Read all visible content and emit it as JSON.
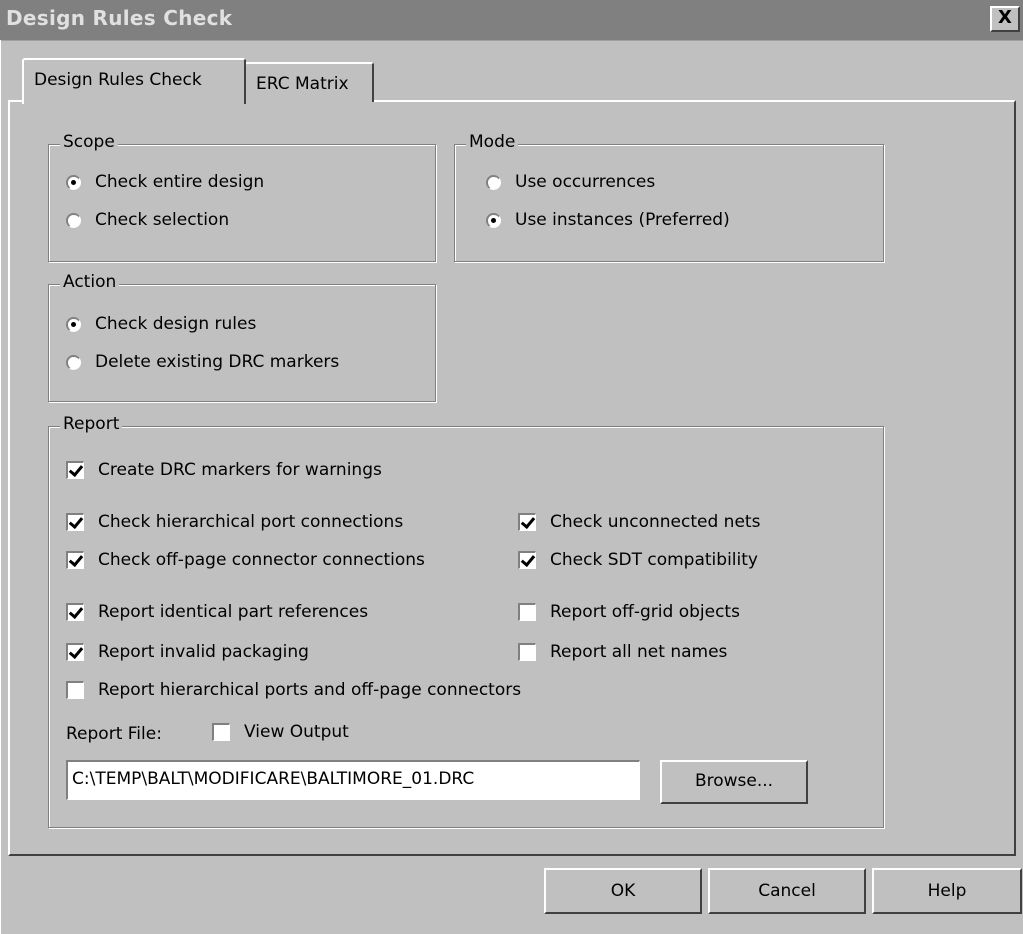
{
  "window": {
    "title": "Design Rules Check",
    "close_glyph": "X"
  },
  "tabs": [
    {
      "label": "Design Rules Check",
      "active": true
    },
    {
      "label": "ERC Matrix",
      "active": false
    }
  ],
  "scope": {
    "legend": "Scope",
    "options": [
      {
        "label": "Check entire design",
        "selected": true
      },
      {
        "label": "Check selection",
        "selected": false
      }
    ]
  },
  "mode": {
    "legend": "Mode",
    "options": [
      {
        "label": "Use occurrences",
        "selected": false
      },
      {
        "label": "Use instances (Preferred)",
        "selected": true
      }
    ]
  },
  "action": {
    "legend": "Action",
    "options": [
      {
        "label": "Check design rules",
        "selected": true
      },
      {
        "label": "Delete existing DRC markers",
        "selected": false
      }
    ]
  },
  "report": {
    "legend": "Report",
    "checks": [
      {
        "label": "Create DRC markers for warnings",
        "checked": true
      },
      {
        "label": "Check hierarchical port connections",
        "checked": true
      },
      {
        "label": "Check unconnected nets",
        "checked": true
      },
      {
        "label": "Check off-page connector connections",
        "checked": true
      },
      {
        "label": "Check SDT compatibility",
        "checked": true
      },
      {
        "label": "Report identical part references",
        "checked": true
      },
      {
        "label": "Report off-grid objects",
        "checked": false
      },
      {
        "label": "Report invalid packaging",
        "checked": true
      },
      {
        "label": "Report all net names",
        "checked": false
      },
      {
        "label": "Report hierarchical ports and off-page connectors",
        "checked": false
      }
    ],
    "report_file_label": "Report File:",
    "view_output": {
      "label": "View Output",
      "checked": false
    },
    "file_path": "C:\\TEMP\\BALT\\MODIFICARE\\BALTIMORE_01.DRC",
    "browse_label": "Browse..."
  },
  "footer": {
    "ok_label": "OK",
    "cancel_label": "Cancel",
    "help_label": "Help"
  }
}
